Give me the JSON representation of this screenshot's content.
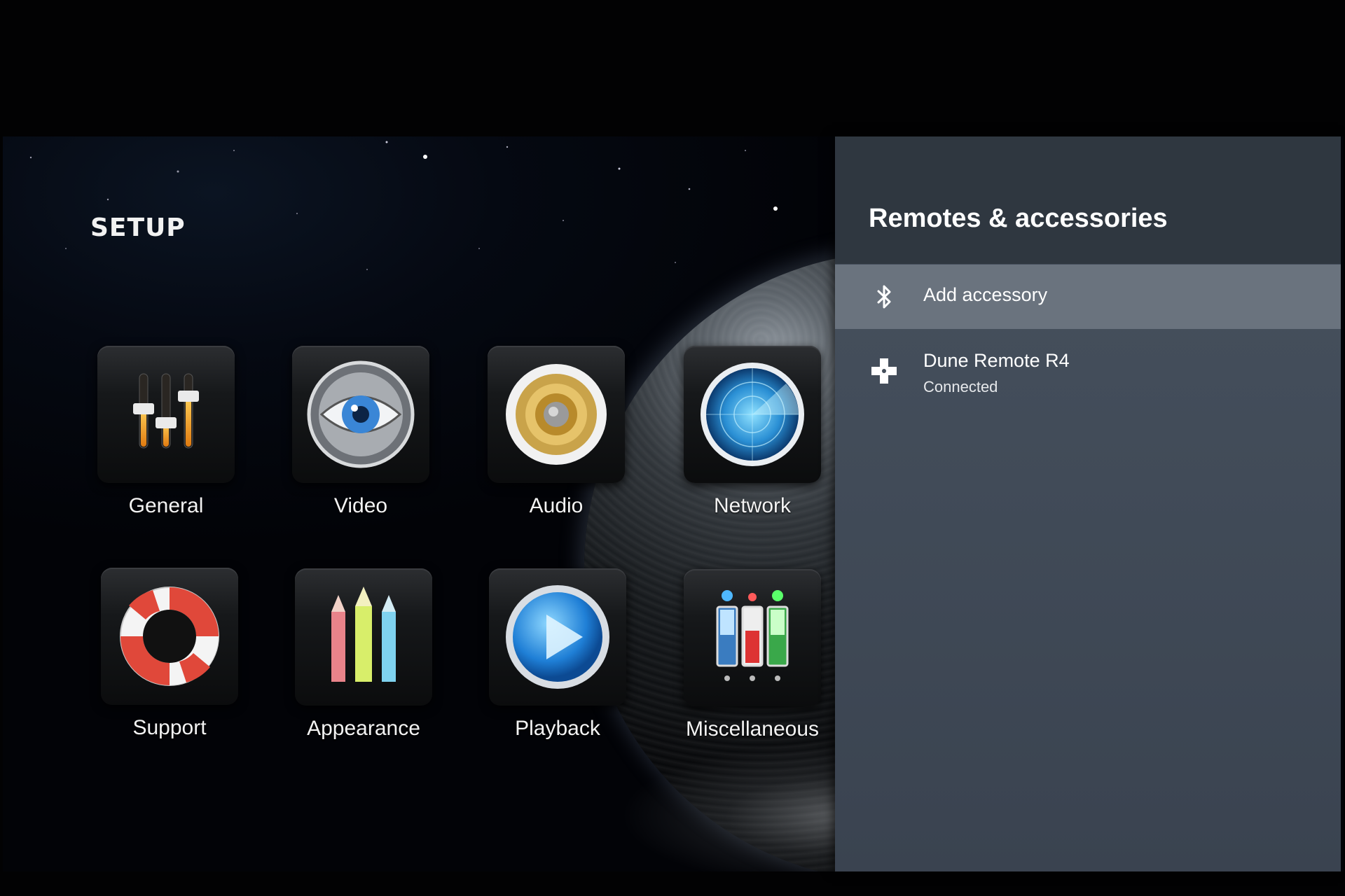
{
  "setup": {
    "title": "SETUP"
  },
  "tiles": [
    {
      "label": "General",
      "icon": "equalizer-sliders-icon"
    },
    {
      "label": "Video",
      "icon": "eye-icon"
    },
    {
      "label": "Audio",
      "icon": "speaker-icon"
    },
    {
      "label": "Network",
      "icon": "radar-icon"
    },
    {
      "label": "Support",
      "icon": "lifebuoy-icon"
    },
    {
      "label": "Appearance",
      "icon": "pencils-icon"
    },
    {
      "label": "Playback",
      "icon": "play-icon"
    },
    {
      "label": "Miscellaneous",
      "icon": "switches-icon"
    }
  ],
  "panel": {
    "title": "Remotes & accessories",
    "items": [
      {
        "label": "Add accessory",
        "icon": "bluetooth-icon",
        "selected": true
      },
      {
        "label": "Dune Remote R4",
        "status": "Connected",
        "icon": "gamepad-dpad-icon",
        "selected": false
      }
    ]
  },
  "colors": {
    "panel_bg": "#434d5a",
    "panel_header": "#2f3740",
    "selected_row": "#6a737e"
  }
}
